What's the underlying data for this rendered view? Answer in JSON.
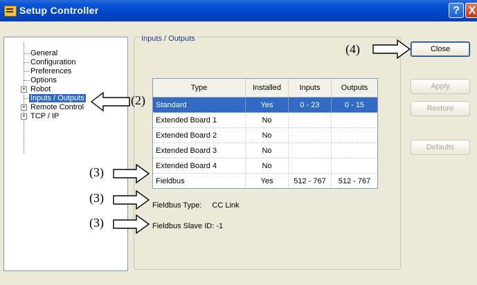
{
  "window": {
    "title": "Setup Controller",
    "help_glyph": "?",
    "close_glyph": "X"
  },
  "tree": [
    {
      "label": "General",
      "expandable": false
    },
    {
      "label": "Configuration",
      "expandable": false
    },
    {
      "label": "Preferences",
      "expandable": false
    },
    {
      "label": "Options",
      "expandable": false
    },
    {
      "label": "Robot",
      "expandable": true
    },
    {
      "label": "Inputs / Outputs",
      "expandable": false,
      "selected": true
    },
    {
      "label": "Remote Control",
      "expandable": true
    },
    {
      "label": "TCP / IP",
      "expandable": true
    }
  ],
  "group": {
    "title": "Inputs / Outputs"
  },
  "table": {
    "headers": [
      "Type",
      "Installed",
      "Inputs",
      "Outputs"
    ],
    "rows": [
      {
        "type": "Standard",
        "installed": "Yes",
        "inputs": "0 - 23",
        "outputs": "0 - 15",
        "selected": true
      },
      {
        "type": "Extended Board 1",
        "installed": "No",
        "inputs": "",
        "outputs": ""
      },
      {
        "type": "Extended Board 2",
        "installed": "No",
        "inputs": "",
        "outputs": ""
      },
      {
        "type": "Extended Board 3",
        "installed": "No",
        "inputs": "",
        "outputs": ""
      },
      {
        "type": "Extended Board 4",
        "installed": "No",
        "inputs": "",
        "outputs": ""
      },
      {
        "type": "Fieldbus",
        "installed": "Yes",
        "inputs": "512 - 767",
        "outputs": "512 - 767"
      }
    ]
  },
  "fieldbus": {
    "type_label": "Fieldbus Type:",
    "type_value": "CC Link",
    "slave_label": "Fieldbus Slave ID:",
    "slave_value": "-1"
  },
  "buttons": {
    "close": "Close",
    "apply": "Apply",
    "restore": "Restore",
    "defaults": "Defaults"
  },
  "callouts": {
    "c2": "(2)",
    "c3a": "(3)",
    "c3b": "(3)",
    "c3c": "(3)",
    "c4": "(4)"
  },
  "colors": {
    "titlebar": "#0a56d6",
    "selection": "#316ac5",
    "window_bg": "#ece9d8"
  }
}
